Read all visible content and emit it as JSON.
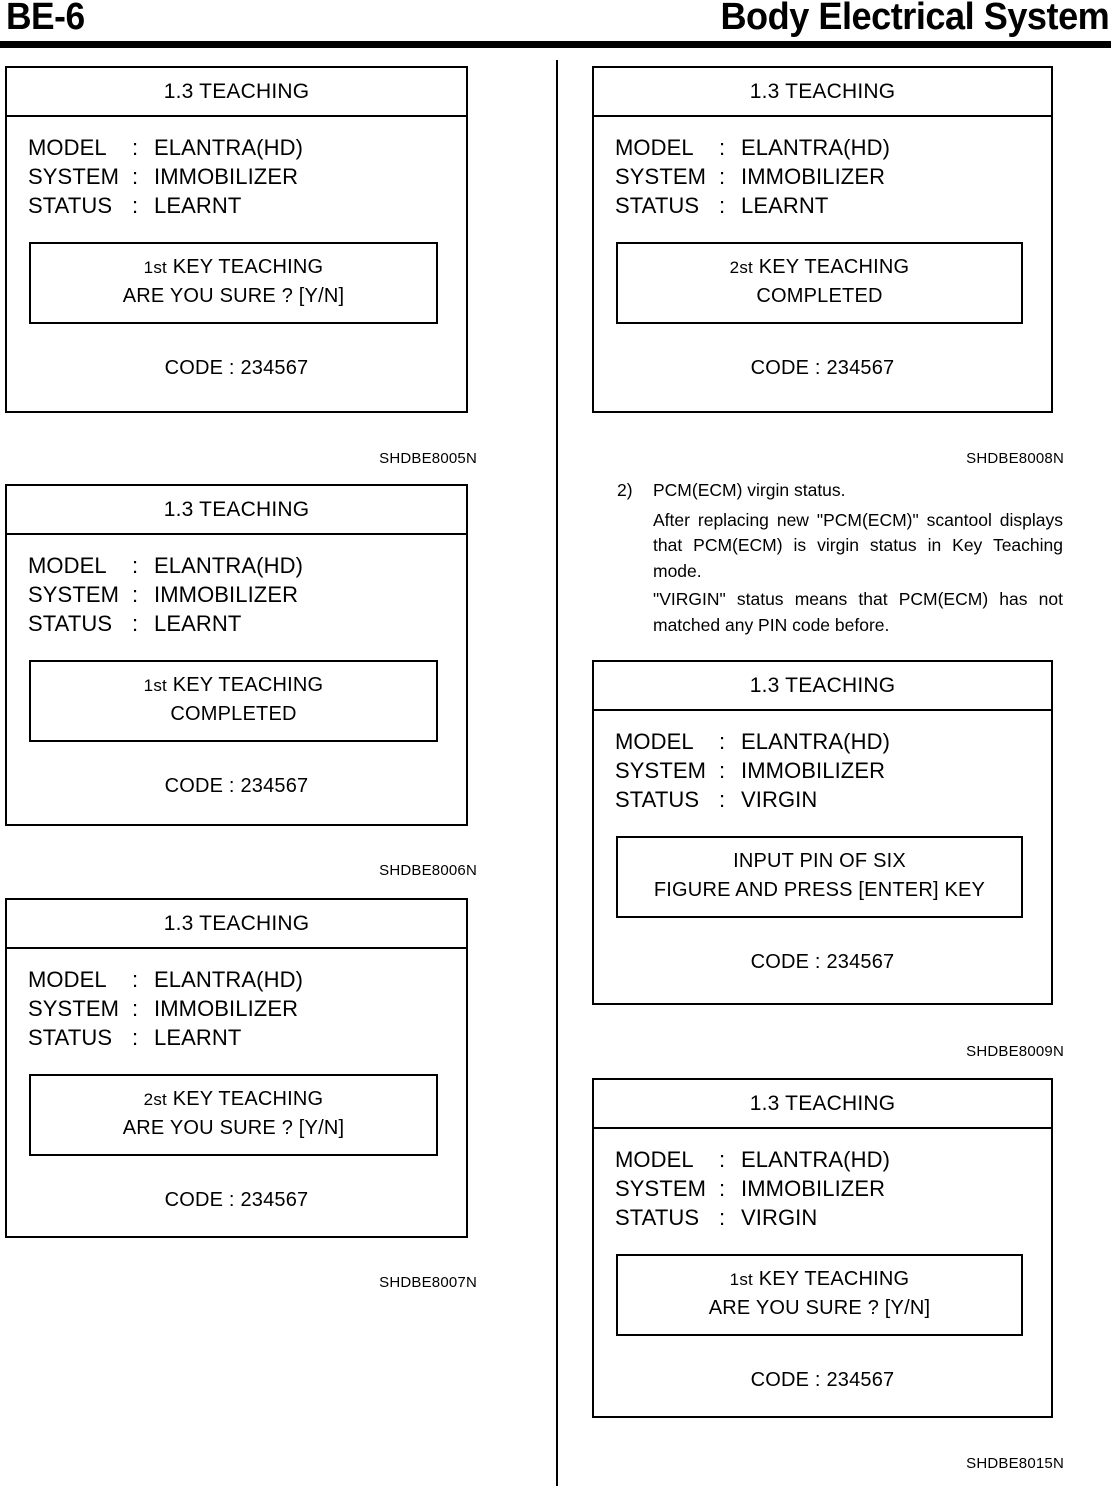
{
  "header": {
    "page_number": "BE-6",
    "title": "Body Electrical System"
  },
  "panels": [
    {
      "id": "panel-left-1",
      "title": "1.3 TEACHING",
      "fields": [
        {
          "label": "MODEL",
          "colon": ":",
          "value": "ELANTRA(HD)"
        },
        {
          "label": "SYSTEM",
          "colon": ":",
          "value": "IMMOBILIZER"
        },
        {
          "label": "STATUS",
          "colon": ":",
          "value": "LEARNT"
        }
      ],
      "message": {
        "ordinal": "1st",
        "line1_rest": " KEY TEACHING",
        "line2": "ARE YOU SURE ? [Y/N]"
      },
      "code": "CODE : 234567",
      "caption": "SHDBE8005N"
    },
    {
      "id": "panel-left-2",
      "title": "1.3 TEACHING",
      "fields": [
        {
          "label": "MODEL",
          "colon": ":",
          "value": "ELANTRA(HD)"
        },
        {
          "label": "SYSTEM",
          "colon": ":",
          "value": "IMMOBILIZER"
        },
        {
          "label": "STATUS",
          "colon": ":",
          "value": "LEARNT"
        }
      ],
      "message": {
        "ordinal": "1st",
        "line1_rest": " KEY TEACHING",
        "line2": "COMPLETED"
      },
      "code": "CODE : 234567",
      "caption": "SHDBE8006N"
    },
    {
      "id": "panel-left-3",
      "title": "1.3 TEACHING",
      "fields": [
        {
          "label": "MODEL",
          "colon": ":",
          "value": "ELANTRA(HD)"
        },
        {
          "label": "SYSTEM",
          "colon": ":",
          "value": "IMMOBILIZER"
        },
        {
          "label": "STATUS",
          "colon": ":",
          "value": "LEARNT"
        }
      ],
      "message": {
        "ordinal": "2st",
        "line1_rest": " KEY TEACHING",
        "line2": "ARE YOU SURE ? [Y/N]"
      },
      "code": "CODE : 234567",
      "caption": "SHDBE8007N"
    },
    {
      "id": "panel-right-1",
      "title": "1.3 TEACHING",
      "fields": [
        {
          "label": "MODEL",
          "colon": ":",
          "value": "ELANTRA(HD)"
        },
        {
          "label": "SYSTEM",
          "colon": ":",
          "value": "IMMOBILIZER"
        },
        {
          "label": "STATUS",
          "colon": ":",
          "value": "LEARNT"
        }
      ],
      "message": {
        "ordinal": "2st",
        "line1_rest": " KEY TEACHING",
        "line2": "COMPLETED"
      },
      "code": "CODE : 234567",
      "caption": "SHDBE8008N"
    },
    {
      "id": "panel-right-2",
      "title": "1.3 TEACHING",
      "fields": [
        {
          "label": "MODEL",
          "colon": ":",
          "value": "ELANTRA(HD)"
        },
        {
          "label": "SYSTEM",
          "colon": ":",
          "value": "IMMOBILIZER"
        },
        {
          "label": "STATUS",
          "colon": ":",
          "value": "VIRGIN"
        }
      ],
      "message": {
        "ordinal": "",
        "line1_rest": "INPUT PIN OF SIX",
        "line2": "FIGURE AND PRESS [ENTER] KEY"
      },
      "code": "CODE : 234567",
      "caption": "SHDBE8009N"
    },
    {
      "id": "panel-right-3",
      "title": "1.3 TEACHING",
      "fields": [
        {
          "label": "MODEL",
          "colon": ":",
          "value": "ELANTRA(HD)"
        },
        {
          "label": "SYSTEM",
          "colon": ":",
          "value": "IMMOBILIZER"
        },
        {
          "label": "STATUS",
          "colon": ":",
          "value": "VIRGIN"
        }
      ],
      "message": {
        "ordinal": "1st",
        "line1_rest": " KEY TEACHING",
        "line2": "ARE YOU SURE ? [Y/N]"
      },
      "code": "CODE : 234567",
      "caption": "SHDBE8015N"
    }
  ],
  "body_copy": {
    "item_marker": "2)",
    "item_text": "PCM(ECM) virgin status.",
    "paragraph_1": "After replacing new \"PCM(ECM)\" scantool displays that PCM(ECM) is virgin status in Key Teaching mode.",
    "paragraph_2": "\"VIRGIN\" status means that PCM(ECM) has not matched any PIN code before."
  }
}
